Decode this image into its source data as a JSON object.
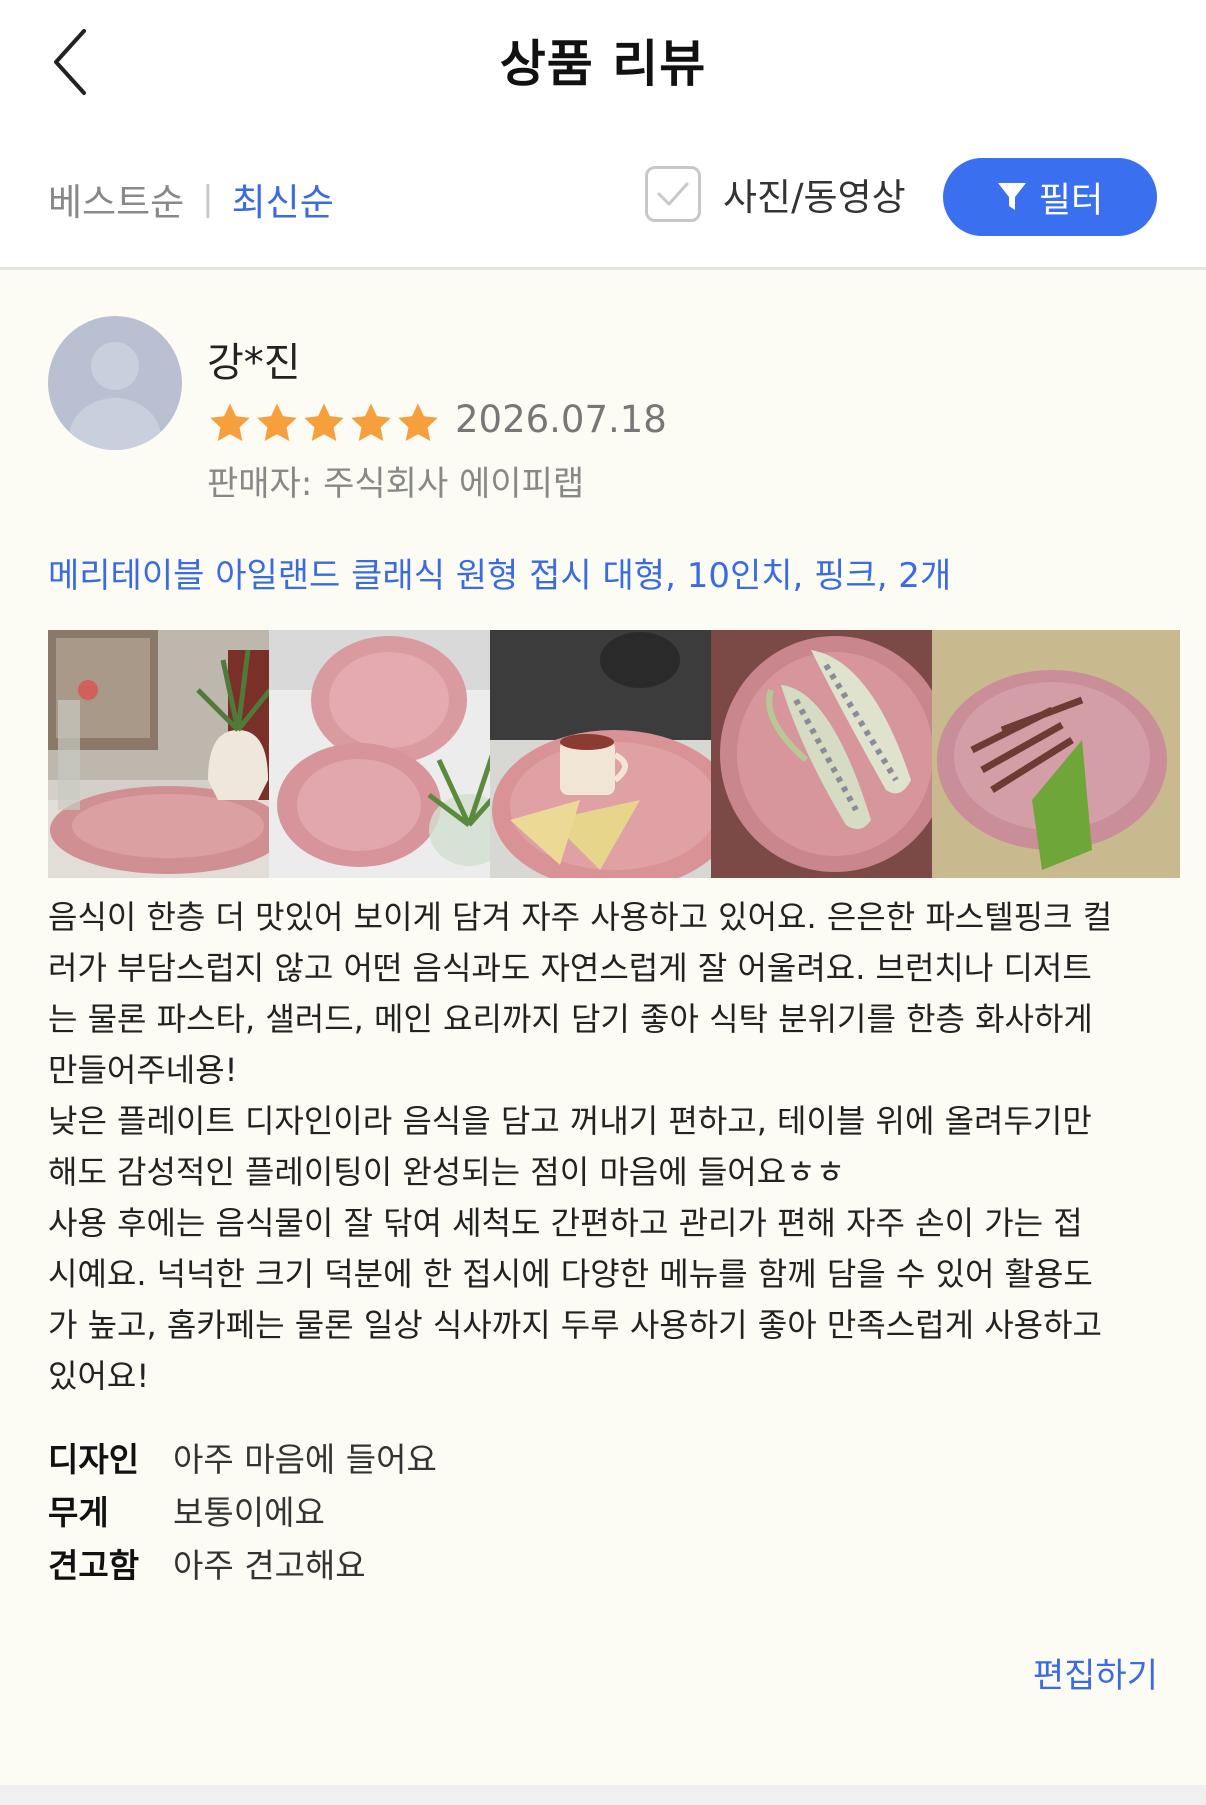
{
  "header": {
    "title": "상품 리뷰"
  },
  "toolbar": {
    "sort_best": "베스트순",
    "sort_separator": "|",
    "sort_latest": "최신순",
    "photo_video_label": "사진/동영상",
    "photo_video_checked": false,
    "filter_label": "필터"
  },
  "review": {
    "reviewer_name": "강*진",
    "rating": 5,
    "rating_max": 5,
    "date": "2026.07.18",
    "seller": "판매자: 주식회사 에이피랩",
    "product_option": "메리테이블 아일랜드 클래식 원형 접시 대형, 10인치, 핑크, 2개",
    "photos": [
      {
        "icon": "pink-plate-with-plant-photo"
      },
      {
        "icon": "two-pink-plates-photo"
      },
      {
        "icon": "plate-with-omelette-and-tea-photo"
      },
      {
        "icon": "plate-with-corn-photo"
      },
      {
        "icon": "plate-with-snack-photo"
      }
    ],
    "body_lines": [
      "음식이 한층 더 맛있어 보이게 담겨 자주 사용하고 있어요. 은은한 파스텔핑크 컬",
      "러가 부담스럽지 않고 어떤 음식과도 자연스럽게 잘 어울려요. 브런치나 디저트",
      "는 물론 파스타, 샐러드, 메인 요리까지 담기 좋아 식탁 분위기를 한층 화사하게",
      "만들어주네용!",
      "낮은 플레이트 디자인이라 음식을 담고 꺼내기 편하고, 테이블 위에 올려두기만",
      "해도 감성적인 플레이팅이 완성되는 점이 마음에 들어요ㅎㅎ",
      "사용 후에는 음식물이 잘 닦여 세척도 간편하고 관리가 편해 자주 손이 가는 접",
      "시예요. 넉넉한 크기 덕분에 한 접시에 다양한 메뉴를 함께 담을 수 있어 활용도",
      "가 높고, 홈카페는 물론 일상 식사까지 두루 사용하기 좋아 만족스럽게 사용하고",
      "있어요!"
    ],
    "ratings": [
      {
        "label": "디자인",
        "value": "아주 마음에 들어요"
      },
      {
        "label": "무게",
        "value": "보통이에요"
      },
      {
        "label": "견고함",
        "value": "아주 견고해요"
      }
    ],
    "edit_label": "편집하기"
  },
  "colors": {
    "accent": "#3a6ff0",
    "link": "#3a6be0",
    "star": "#f5a03c",
    "background": "#fdfcf4"
  }
}
